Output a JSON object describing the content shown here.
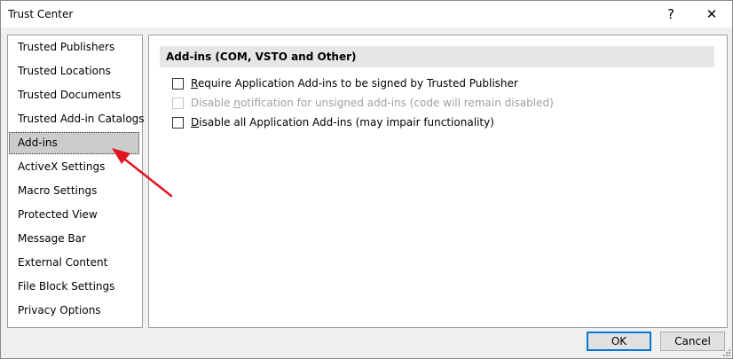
{
  "window": {
    "title": "Trust Center",
    "help_label": "?",
    "close_label": "✕"
  },
  "sidebar": {
    "items": [
      {
        "label": "Trusted Publishers"
      },
      {
        "label": "Trusted Locations"
      },
      {
        "label": "Trusted Documents"
      },
      {
        "label": "Trusted Add-in Catalogs"
      },
      {
        "label": "Add-ins",
        "selected": true
      },
      {
        "label": "ActiveX Settings"
      },
      {
        "label": "Macro Settings"
      },
      {
        "label": "Protected View"
      },
      {
        "label": "Message Bar"
      },
      {
        "label": "External Content"
      },
      {
        "label": "File Block Settings"
      },
      {
        "label": "Privacy Options"
      }
    ]
  },
  "main": {
    "section_title": "Add-ins (COM, VSTO and Other)",
    "options": [
      {
        "pre": "",
        "u": "R",
        "post": "equire Application Add-ins to be signed by Trusted Publisher",
        "checked": false,
        "enabled": true
      },
      {
        "pre": "Disable ",
        "u": "n",
        "post": "otification for unsigned add-ins (code will remain disabled)",
        "checked": false,
        "enabled": false
      },
      {
        "pre": "",
        "u": "D",
        "post": "isable all Application Add-ins (may impair functionality)",
        "checked": false,
        "enabled": true
      }
    ]
  },
  "footer": {
    "ok_label": "OK",
    "cancel_label": "Cancel"
  },
  "colors": {
    "selected_bg": "#cccccc",
    "section_header_bg": "#e6e6e6",
    "default_button_border": "#0078d7",
    "annotation_arrow": "#e0141e"
  }
}
